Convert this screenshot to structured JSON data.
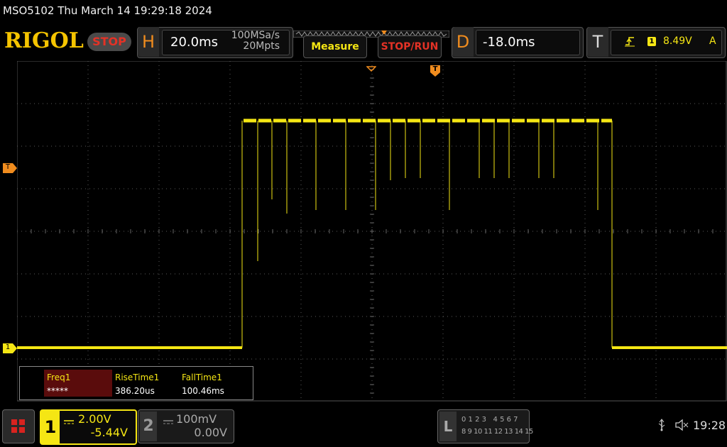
{
  "title": "MSO5102  Thu March 14 19:29:18 2024",
  "logo": "RIGOL",
  "run_status": "STOP",
  "horizontal": {
    "letter": "H",
    "timebase": "20.0ms",
    "sample_rate": "100MSa/s",
    "memory_depth": "20Mpts"
  },
  "buttons": {
    "measure": "Measure",
    "stop_run": "STOP/RUN"
  },
  "delay": {
    "letter": "D",
    "value": "-18.0ms"
  },
  "trigger": {
    "letter": "T",
    "source": "1",
    "level": "8.49V",
    "mode": "A"
  },
  "markers": {
    "trigger_level": "T",
    "channel1": "1",
    "trigger_pos": "T"
  },
  "measurements": {
    "headers": [
      "Freq1",
      "RiseTime1",
      "FallTime1"
    ],
    "values": [
      "*****",
      "386.20us",
      "100.46ms"
    ]
  },
  "channel1": {
    "number": "1",
    "scale": "2.00V",
    "offset": "-5.44V",
    "color": "#f5e614"
  },
  "channel2": {
    "number": "2",
    "scale": "100mV",
    "offset": "0.00V"
  },
  "logic": {
    "letter": "L",
    "row1": "0 1 2 3   4 5 6 7",
    "row2": "8 9 10 11 12 13 14 15"
  },
  "clock": "19:28",
  "colors": {
    "accent": "#f08c1e",
    "stop": "#e43226",
    "logo": "#f5c400",
    "trace": "#f5e614"
  }
}
